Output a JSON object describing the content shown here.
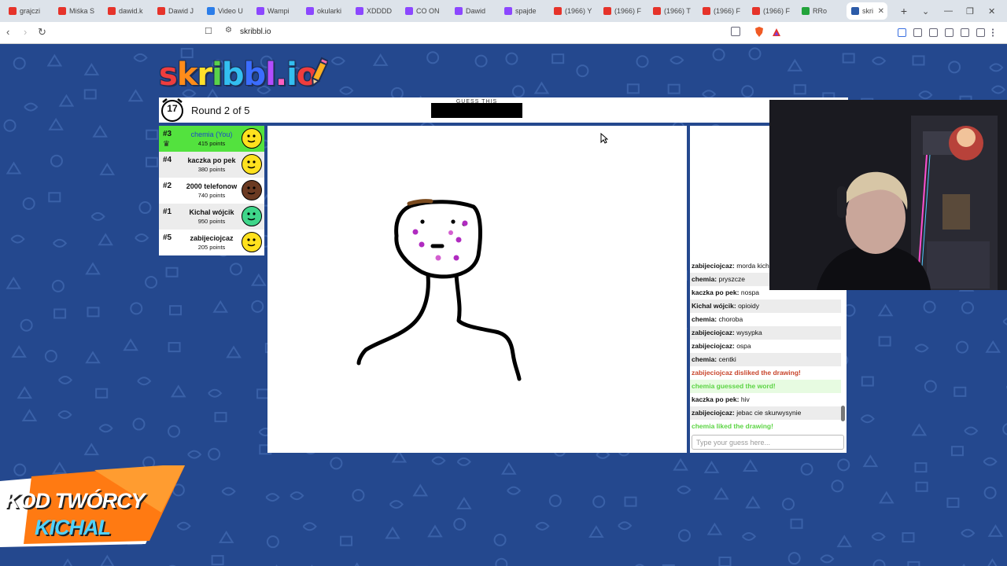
{
  "browser": {
    "tabs": [
      {
        "label": "grajczi",
        "color": "#e6332a"
      },
      {
        "label": "Miśka S",
        "color": "#e6332a"
      },
      {
        "label": "dawid.k",
        "color": "#e6332a"
      },
      {
        "label": "Dawid J",
        "color": "#e6332a"
      },
      {
        "label": "Video U",
        "color": "#2b7de9"
      },
      {
        "label": "Wampi",
        "color": "#8c47ff"
      },
      {
        "label": "okularki",
        "color": "#8c47ff"
      },
      {
        "label": "XDDDD",
        "color": "#8c47ff"
      },
      {
        "label": "CO ON",
        "color": "#8c47ff"
      },
      {
        "label": "Dawid",
        "color": "#8c47ff"
      },
      {
        "label": "spajde",
        "color": "#8c47ff"
      },
      {
        "label": "(1966) Y",
        "color": "#e6332a"
      },
      {
        "label": "(1966) F",
        "color": "#e6332a"
      },
      {
        "label": "(1966) T",
        "color": "#e6332a"
      },
      {
        "label": "(1966) F",
        "color": "#e6332a"
      },
      {
        "label": "(1966) F",
        "color": "#e6332a"
      },
      {
        "label": "RRo",
        "color": "#22a33b"
      }
    ],
    "active_tab": {
      "label": "skri",
      "color": "#2c5ba8"
    },
    "url": "skribbl.io"
  },
  "game": {
    "logo": [
      "s",
      "k",
      "r",
      "i",
      "b",
      "b",
      "l",
      ".",
      "i",
      "o"
    ],
    "timer": "17",
    "round": "Round 2 of 5",
    "hint": "GUESS THIS"
  },
  "players": [
    {
      "rank": "#3",
      "name": "chemia (You)",
      "points": "415 points",
      "style": "me",
      "avatar_color": "#ffe11e"
    },
    {
      "rank": "#4",
      "name": "kaczka po pek",
      "points": "380 points",
      "style": "alt",
      "avatar_color": "#ffe11e"
    },
    {
      "rank": "#2",
      "name": "2000 telefonow",
      "points": "740 points",
      "style": "plain",
      "avatar_color": "#6b3a22"
    },
    {
      "rank": "#1",
      "name": "Kichal wójcik",
      "points": "950 points",
      "style": "alt",
      "avatar_color": "#3fd68a"
    },
    {
      "rank": "#5",
      "name": "zabijeciojcaz",
      "points": "205 points",
      "style": "plain",
      "avatar_color": "#ffe11e"
    }
  ],
  "chat": {
    "messages": [
      {
        "user": "zabijeciojcaz:",
        "text": "morda kich",
        "kind": "plain"
      },
      {
        "user": "chemia:",
        "text": "pryszcze",
        "kind": "alt"
      },
      {
        "user": "kaczka po pek:",
        "text": "nospa",
        "kind": "plain"
      },
      {
        "user": "Kichal wójcik:",
        "text": "opioidy",
        "kind": "alt"
      },
      {
        "user": "chemia:",
        "text": "choroba",
        "kind": "plain"
      },
      {
        "user": "zabijeciojcaz:",
        "text": "wysypka",
        "kind": "alt"
      },
      {
        "user": "zabijeciojcaz:",
        "text": "ospa",
        "kind": "plain"
      },
      {
        "user": "chemia:",
        "text": "centki",
        "kind": "alt"
      },
      {
        "user": "",
        "text": "zabijeciojcaz disliked the drawing!",
        "kind": "red"
      },
      {
        "user": "",
        "text": "chemia guessed the word!",
        "kind": "greenbg"
      },
      {
        "user": "kaczka po pek:",
        "text": "hiv",
        "kind": "plain"
      },
      {
        "user": "zabijeciojcaz:",
        "text": "jebac cie skurwysynie",
        "kind": "alt"
      },
      {
        "user": "",
        "text": "chemia liked the drawing!",
        "kind": "green"
      }
    ],
    "placeholder": "Type your guess here..."
  },
  "promo": {
    "line1": "KOD TWÓRCY",
    "line2": "KICHAL"
  }
}
